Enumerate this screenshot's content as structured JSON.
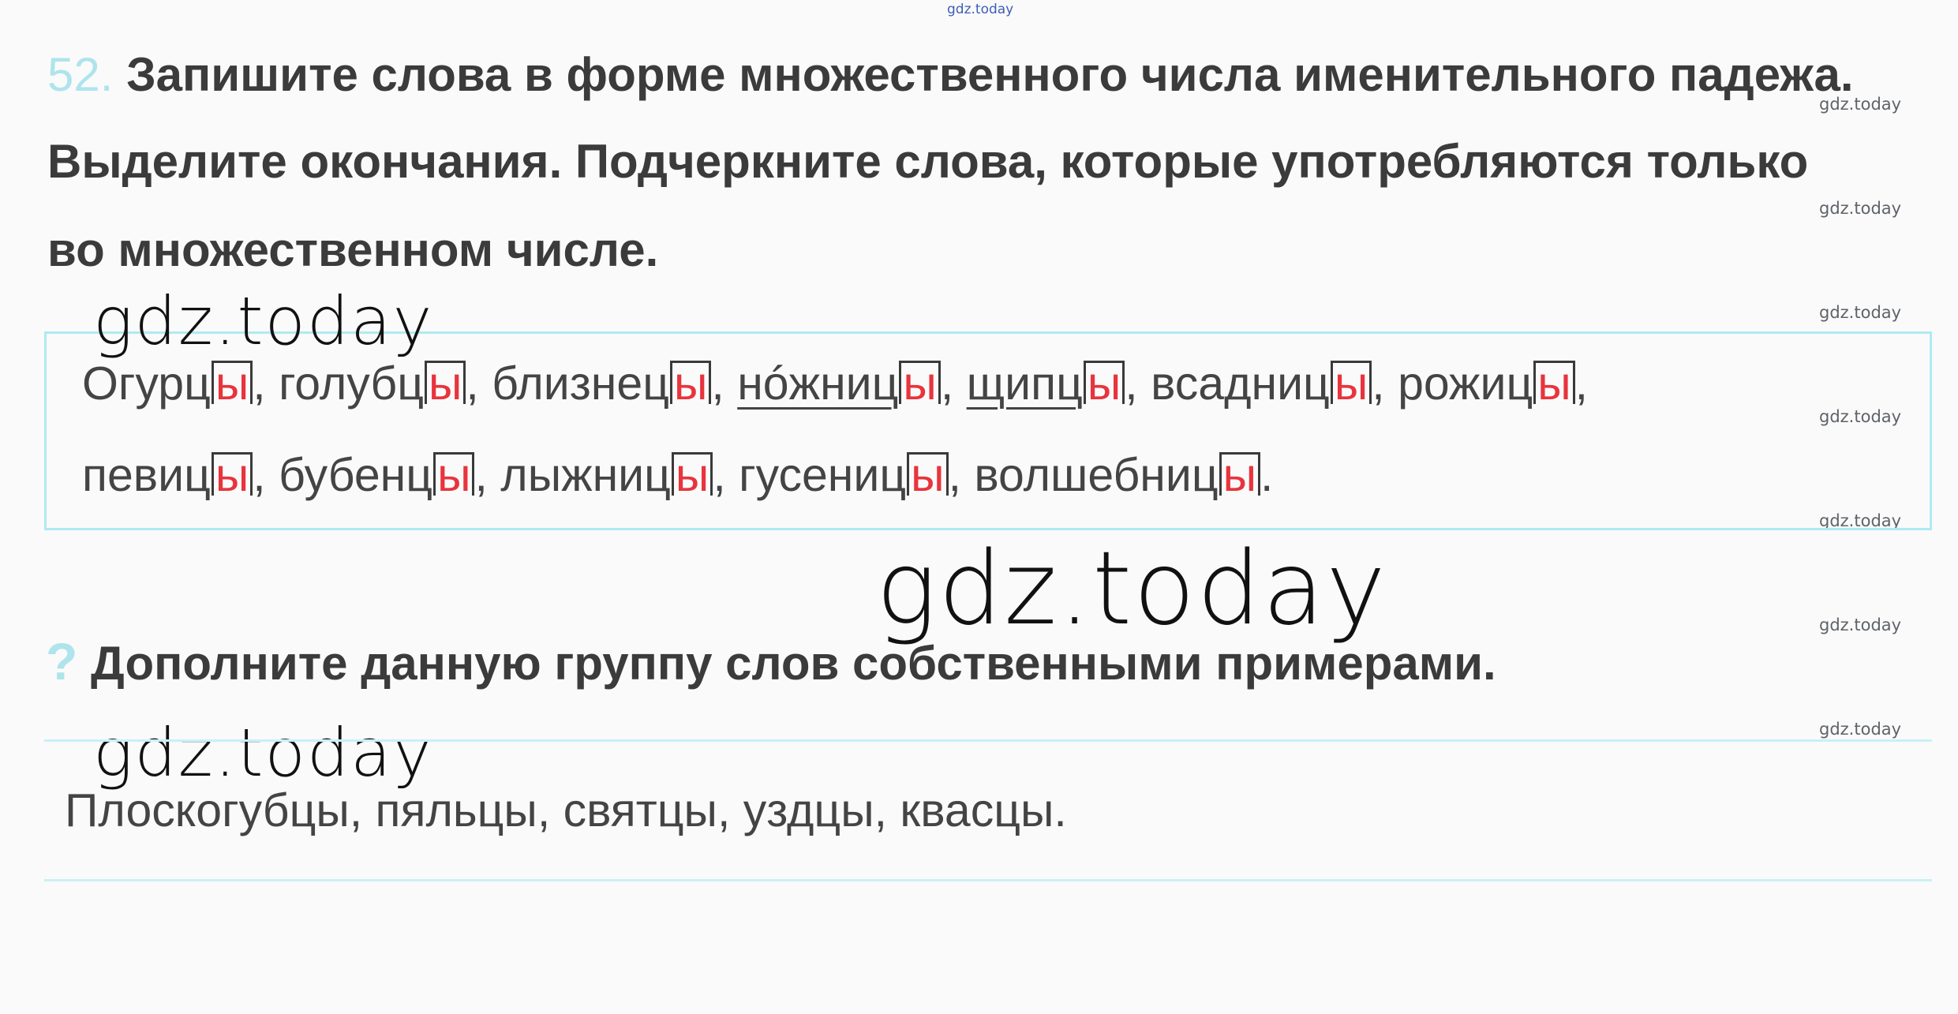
{
  "watermark_top": "gdz.today",
  "watermark_side": [
    "gdz.today",
    "gdz.today",
    "gdz.today",
    "gdz.today",
    "gdz.today",
    "gdz.today",
    "gdz.today"
  ],
  "watermark_large": [
    "gdz.today",
    "gdz.today",
    "gdz.today"
  ],
  "task": {
    "number": "52.",
    "lines": [
      "Запишите слова в форме множественного числа именительного падежа.",
      "Выделите окончания. Подчеркните слова, которые употребляются только",
      "во множественном числе."
    ]
  },
  "answer": {
    "line1": [
      {
        "stem": "Огурц",
        "ending": "ы",
        "sep": ",",
        "underlined": false
      },
      {
        "stem": "голубц",
        "ending": "ы",
        "sep": ",",
        "underlined": false
      },
      {
        "stem": "близнец",
        "ending": "ы",
        "sep": ",",
        "underlined": false
      },
      {
        "stem": "нóжниц",
        "ending": "ы",
        "sep": ",",
        "underlined": true
      },
      {
        "stem": "щипц",
        "ending": "ы",
        "sep": ",",
        "underlined": true
      },
      {
        "stem": "всадниц",
        "ending": "ы",
        "sep": ",",
        "underlined": false
      },
      {
        "stem": "рожиц",
        "ending": "ы",
        "sep": ",",
        "underlined": false
      }
    ],
    "line2": [
      {
        "stem": "певиц",
        "ending": "ы",
        "sep": ",",
        "underlined": false
      },
      {
        "stem": "бубенц",
        "ending": "ы",
        "sep": ",",
        "underlined": false
      },
      {
        "stem": "лыжниц",
        "ending": "ы",
        "sep": ",",
        "underlined": false
      },
      {
        "stem": "гусениц",
        "ending": "ы",
        "sep": ",",
        "underlined": false
      },
      {
        "stem": "волшебниц",
        "ending": "ы",
        "sep": ".",
        "underlined": false
      }
    ]
  },
  "question": {
    "mark": "?",
    "text": "Дополните данную группу слов собственными примерами."
  },
  "extra_answer": "Плоскогубцы, пяльцы, святцы, уздцы, квасцы.",
  "colors": {
    "accent": "#aee4ec",
    "ending": "#e8343d",
    "text": "#3b3b3b"
  }
}
